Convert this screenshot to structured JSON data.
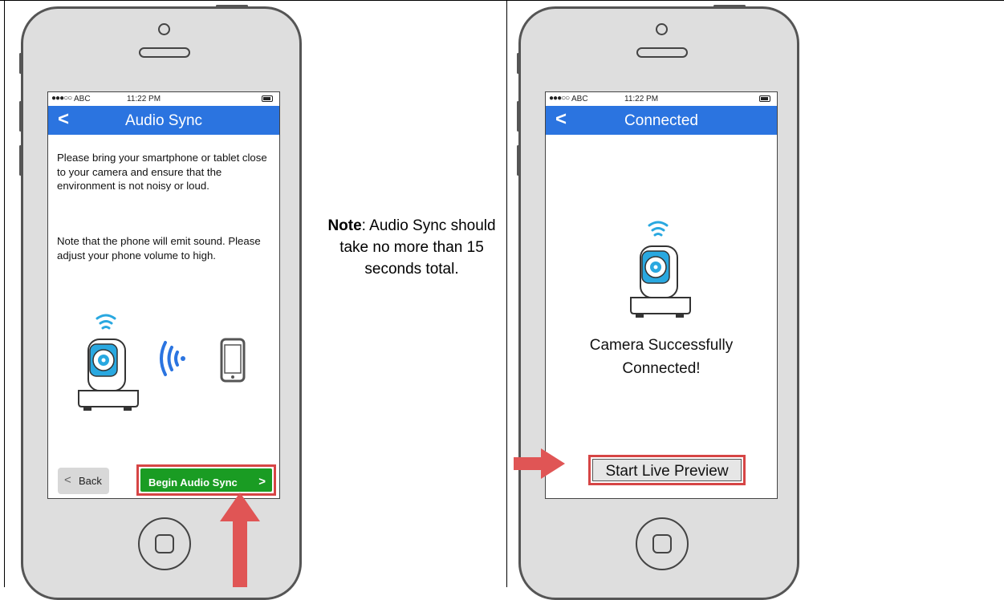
{
  "note": {
    "label": "Note",
    "text": ": Audio Sync should take no more than 15 seconds total."
  },
  "left_phone": {
    "status": {
      "signal": "●●●○○",
      "carrier": "ABC",
      "time": "11:22 PM"
    },
    "nav_title": "Audio Sync",
    "nav_back_icon": "<",
    "paragraph1": "Please bring your smartphone or tablet close to your camera and ensure that the environment is not noisy or loud.",
    "paragraph2": "Note that the phone will emit sound. Please adjust your phone volume to high.",
    "back_button": {
      "icon": "<",
      "label": "Back"
    },
    "primary_button": {
      "label": "Begin Audio Sync",
      "icon": ">"
    }
  },
  "right_phone": {
    "status": {
      "signal": "●●●○○",
      "carrier": "ABC",
      "time": "11:22 PM"
    },
    "nav_title": "Connected",
    "nav_back_icon": "<",
    "message_line1": "Camera Successfully",
    "message_line2": "Connected!",
    "primary_button": {
      "label": "Start Live Preview"
    }
  },
  "colors": {
    "nav_blue": "#2b74e0",
    "green_button": "#1a9c23",
    "highlight_red": "#d64545",
    "camera_blue": "#29a8e0"
  },
  "icons": [
    "camera-icon",
    "wifi-icon",
    "sound-wave-icon",
    "smartphone-icon",
    "arrow-icon"
  ]
}
